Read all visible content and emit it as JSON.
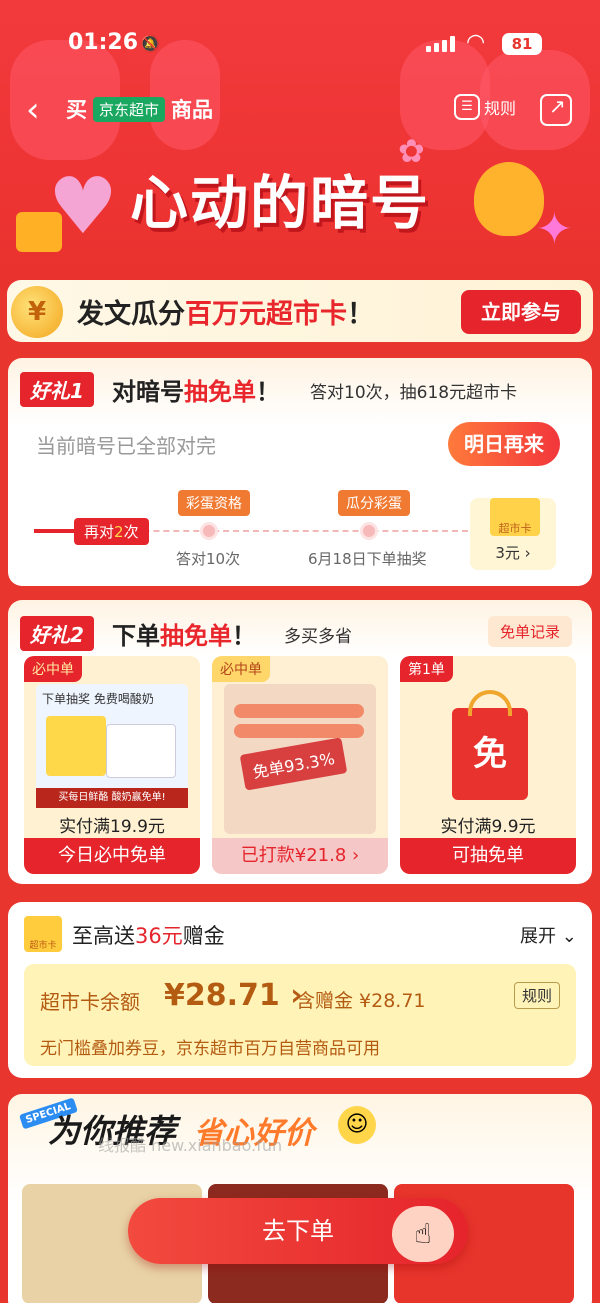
{
  "status": {
    "time": "01:26",
    "battery": "81"
  },
  "nav": {
    "title_pre": "买",
    "badge": "京东超市",
    "title_post": "商品",
    "rules": "规则"
  },
  "hero": {
    "title": "心动的暗号"
  },
  "banner": {
    "coin": "¥",
    "text_pre": "发文瓜分",
    "text_em": "百万元超市卡",
    "text_post": "！",
    "button": "立即参与"
  },
  "gift1": {
    "tag": "好礼1",
    "title_pre": "对暗号",
    "title_em": "抽免单",
    "title_post": "！",
    "subtitle": "答对10次，抽618元超市卡",
    "status": "当前暗号已全部对完",
    "button": "明日再来",
    "progress_pre": "再对",
    "progress_num": "2",
    "progress_post": "次",
    "milestones": [
      {
        "tag": "彩蛋资格",
        "label": "答对10次"
      },
      {
        "tag": "瓜分彩蛋",
        "label": "6月18日下单抽奖"
      }
    ],
    "prize_card": "超市卡",
    "prize_value": "3元 ›"
  },
  "gift2": {
    "tag": "好礼2",
    "title_pre": "下单",
    "title_em": "抽免单",
    "title_post": "！",
    "subtitle": "多买多省",
    "records": "免单记录",
    "prizes": [
      {
        "ribbon": "必中单",
        "img_text_1": "下单抽奖 免费喝酸奶",
        "img_text_2": "买每日鲜酪 酸奶赢免单!",
        "condition": "实付满19.9元",
        "action": "今日必中免单"
      },
      {
        "ribbon": "必中单",
        "img_text_1": "免单93.3%",
        "condition": "",
        "action": "已打款¥21.8 ›"
      },
      {
        "ribbon": "第1单",
        "img_text_1": "免",
        "condition": "实付满9.9元",
        "action": "可抽免单"
      }
    ]
  },
  "gold": {
    "icon_label": "超市卡",
    "title_pre": "至高送",
    "title_em": "36元",
    "title_post": "赠金",
    "expand": "展开 ⌄",
    "balance_label": "超市卡余额",
    "balance": "¥28.71 ›",
    "includes": "含赠金 ¥28.71",
    "rules": "规则",
    "description": "无门槛叠加券豆，京东超市百万自营商品可用"
  },
  "reco": {
    "special": "SPECIAL",
    "title": "为你推荐",
    "subtitle": "省心好价",
    "watermark": "线报酷 new.xianbao.fun"
  },
  "cta": {
    "label": "去下单"
  },
  "colors": {
    "primary": "#e5242b",
    "gold": "#b45b12",
    "bg": "#e8362f"
  }
}
